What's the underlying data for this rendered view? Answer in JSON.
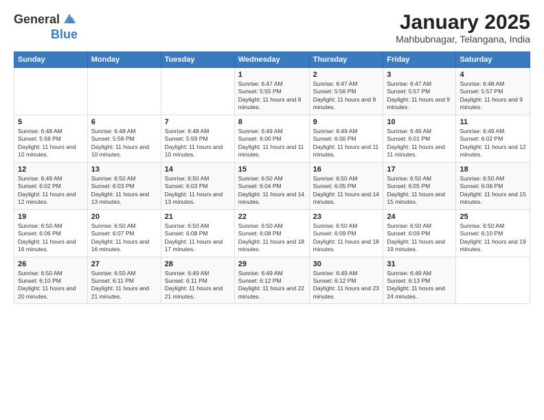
{
  "header": {
    "logo_general": "General",
    "logo_blue": "Blue",
    "month_title": "January 2025",
    "location": "Mahbubnagar, Telangana, India"
  },
  "days_of_week": [
    "Sunday",
    "Monday",
    "Tuesday",
    "Wednesday",
    "Thursday",
    "Friday",
    "Saturday"
  ],
  "weeks": [
    [
      {
        "day": "",
        "info": ""
      },
      {
        "day": "",
        "info": ""
      },
      {
        "day": "",
        "info": ""
      },
      {
        "day": "1",
        "info": "Sunrise: 6:47 AM\nSunset: 5:55 PM\nDaylight: 11 hours and 8 minutes."
      },
      {
        "day": "2",
        "info": "Sunrise: 6:47 AM\nSunset: 5:56 PM\nDaylight: 11 hours and 9 minutes."
      },
      {
        "day": "3",
        "info": "Sunrise: 6:47 AM\nSunset: 5:57 PM\nDaylight: 11 hours and 9 minutes."
      },
      {
        "day": "4",
        "info": "Sunrise: 6:48 AM\nSunset: 5:57 PM\nDaylight: 11 hours and 9 minutes."
      }
    ],
    [
      {
        "day": "5",
        "info": "Sunrise: 6:48 AM\nSunset: 5:58 PM\nDaylight: 11 hours and 10 minutes."
      },
      {
        "day": "6",
        "info": "Sunrise: 6:48 AM\nSunset: 5:58 PM\nDaylight: 11 hours and 10 minutes."
      },
      {
        "day": "7",
        "info": "Sunrise: 6:48 AM\nSunset: 5:59 PM\nDaylight: 11 hours and 10 minutes."
      },
      {
        "day": "8",
        "info": "Sunrise: 6:49 AM\nSunset: 6:00 PM\nDaylight: 11 hours and 11 minutes."
      },
      {
        "day": "9",
        "info": "Sunrise: 6:49 AM\nSunset: 6:00 PM\nDaylight: 11 hours and 11 minutes."
      },
      {
        "day": "10",
        "info": "Sunrise: 6:49 AM\nSunset: 6:01 PM\nDaylight: 11 hours and 11 minutes."
      },
      {
        "day": "11",
        "info": "Sunrise: 6:49 AM\nSunset: 6:02 PM\nDaylight: 11 hours and 12 minutes."
      }
    ],
    [
      {
        "day": "12",
        "info": "Sunrise: 6:49 AM\nSunset: 6:02 PM\nDaylight: 11 hours and 12 minutes."
      },
      {
        "day": "13",
        "info": "Sunrise: 6:50 AM\nSunset: 6:03 PM\nDaylight: 11 hours and 13 minutes."
      },
      {
        "day": "14",
        "info": "Sunrise: 6:50 AM\nSunset: 6:03 PM\nDaylight: 11 hours and 13 minutes."
      },
      {
        "day": "15",
        "info": "Sunrise: 6:50 AM\nSunset: 6:04 PM\nDaylight: 11 hours and 14 minutes."
      },
      {
        "day": "16",
        "info": "Sunrise: 6:50 AM\nSunset: 6:05 PM\nDaylight: 11 hours and 14 minutes."
      },
      {
        "day": "17",
        "info": "Sunrise: 6:50 AM\nSunset: 6:05 PM\nDaylight: 11 hours and 15 minutes."
      },
      {
        "day": "18",
        "info": "Sunrise: 6:50 AM\nSunset: 6:06 PM\nDaylight: 11 hours and 15 minutes."
      }
    ],
    [
      {
        "day": "19",
        "info": "Sunrise: 6:50 AM\nSunset: 6:06 PM\nDaylight: 11 hours and 16 minutes."
      },
      {
        "day": "20",
        "info": "Sunrise: 6:50 AM\nSunset: 6:07 PM\nDaylight: 11 hours and 16 minutes."
      },
      {
        "day": "21",
        "info": "Sunrise: 6:50 AM\nSunset: 6:08 PM\nDaylight: 11 hours and 17 minutes."
      },
      {
        "day": "22",
        "info": "Sunrise: 6:50 AM\nSunset: 6:08 PM\nDaylight: 11 hours and 18 minutes."
      },
      {
        "day": "23",
        "info": "Sunrise: 6:50 AM\nSunset: 6:09 PM\nDaylight: 11 hours and 18 minutes."
      },
      {
        "day": "24",
        "info": "Sunrise: 6:50 AM\nSunset: 6:09 PM\nDaylight: 11 hours and 19 minutes."
      },
      {
        "day": "25",
        "info": "Sunrise: 6:50 AM\nSunset: 6:10 PM\nDaylight: 11 hours and 19 minutes."
      }
    ],
    [
      {
        "day": "26",
        "info": "Sunrise: 6:50 AM\nSunset: 6:10 PM\nDaylight: 11 hours and 20 minutes."
      },
      {
        "day": "27",
        "info": "Sunrise: 6:50 AM\nSunset: 6:11 PM\nDaylight: 11 hours and 21 minutes."
      },
      {
        "day": "28",
        "info": "Sunrise: 6:49 AM\nSunset: 6:11 PM\nDaylight: 11 hours and 21 minutes."
      },
      {
        "day": "29",
        "info": "Sunrise: 6:49 AM\nSunset: 6:12 PM\nDaylight: 11 hours and 22 minutes."
      },
      {
        "day": "30",
        "info": "Sunrise: 6:49 AM\nSunset: 6:12 PM\nDaylight: 11 hours and 23 minutes."
      },
      {
        "day": "31",
        "info": "Sunrise: 6:49 AM\nSunset: 6:13 PM\nDaylight: 11 hours and 24 minutes."
      },
      {
        "day": "",
        "info": ""
      }
    ]
  ]
}
